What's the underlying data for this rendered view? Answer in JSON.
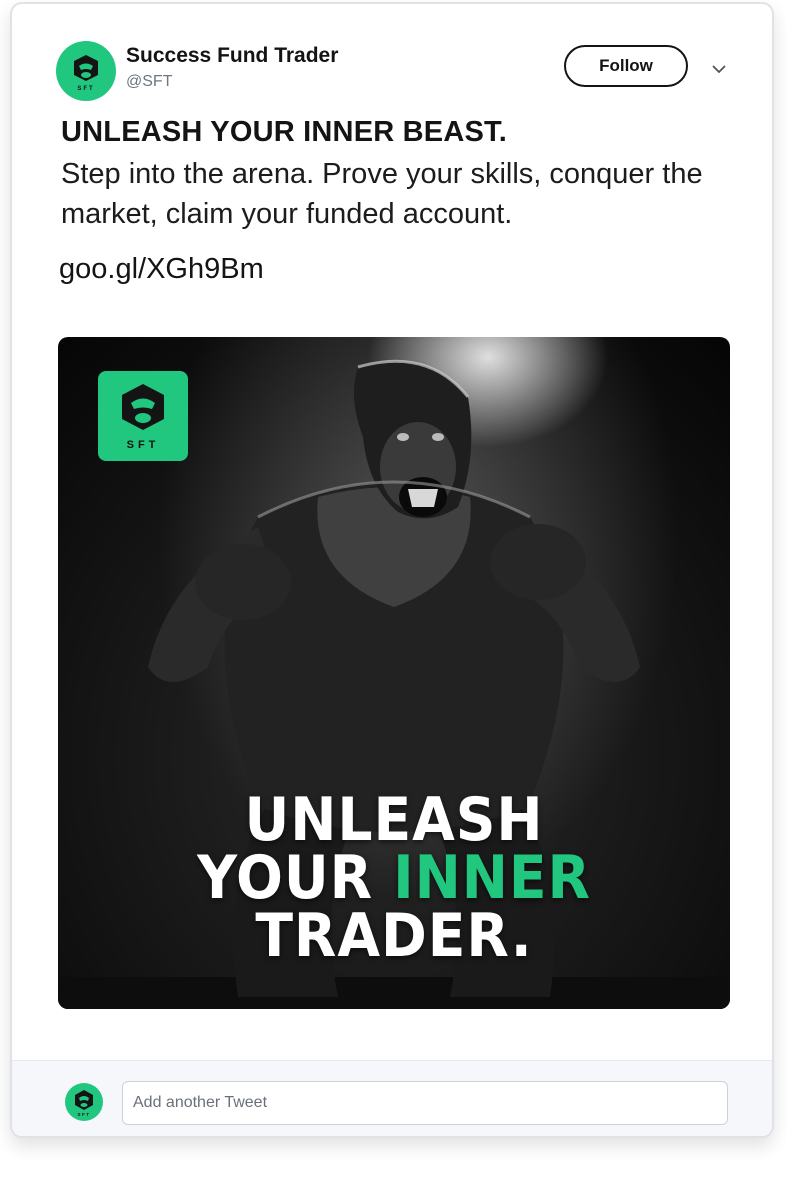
{
  "tweet": {
    "author_name": "Success Fund Trader",
    "author_handle": "@SFT",
    "avatar_text": "SFT",
    "follow_label": "Follow",
    "menu_icon": "chevron-down-icon",
    "headline": "UNLEASH YOUR INNER BEAST.",
    "body": "Step into the arena. Prove your skills, conquer the market, claim your funded account.",
    "link": "goo.gl/XGh9Bm"
  },
  "media": {
    "logo_text": "SFT",
    "overlay_line1": "UNLEASH",
    "overlay_line2_prefix": "YOUR ",
    "overlay_line2_accent": "INNER",
    "overlay_line3": "TRADER."
  },
  "reply": {
    "placeholder": "Add another Tweet",
    "avatar_text": "SFT"
  },
  "colors": {
    "brand_green": "#21c77f",
    "text_dark": "#141414",
    "handle_gray": "#6e7681",
    "footer_bg": "#f5f7fa"
  }
}
